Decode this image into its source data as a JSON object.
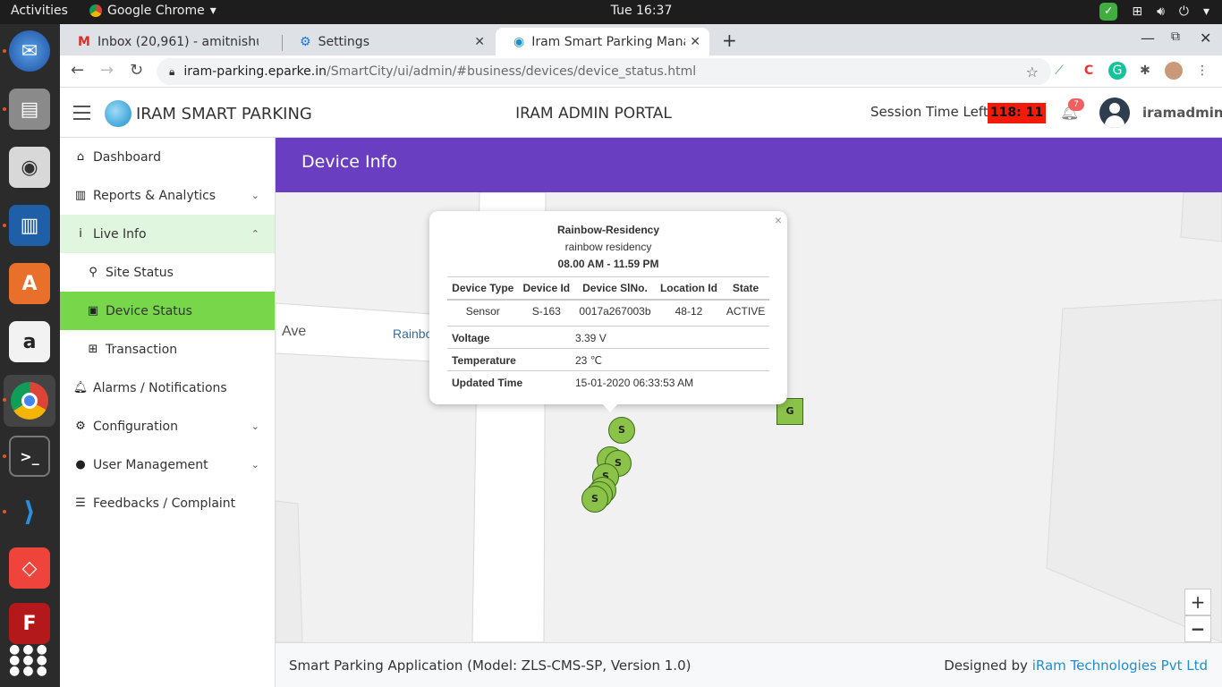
{
  "os": {
    "activities": "Activities",
    "app_name": "Google Chrome",
    "clock": "Tue 16:37"
  },
  "browser": {
    "tabs": [
      {
        "label": "Inbox (20,961) - amitnishu"
      },
      {
        "label": "Settings"
      },
      {
        "label": "Iram Smart Parking Mana"
      }
    ],
    "url_host": "iram-parking.eparke.in",
    "url_path": "/SmartCity/ui/admin/#business/devices/device_status.html"
  },
  "header": {
    "brand": "IRAM SMART PARKING",
    "portal_title": "IRAM ADMIN PORTAL",
    "session_label": "Session Time Left:",
    "session_timer": "118: 11",
    "notification_count": "7",
    "username": "iramadmin"
  },
  "sidebar": {
    "items": [
      {
        "label": "Dashboard"
      },
      {
        "label": "Reports & Analytics"
      },
      {
        "label": "Live Info"
      },
      {
        "label": "Site Status"
      },
      {
        "label": "Device Status"
      },
      {
        "label": "Transaction"
      },
      {
        "label": "Alarms / Notifications"
      },
      {
        "label": "Configuration"
      },
      {
        "label": "User Management"
      },
      {
        "label": "Feedbacks / Complaint"
      }
    ]
  },
  "page": {
    "title": "Device Info"
  },
  "map": {
    "street_labels": [
      "Ave",
      "Rainbo"
    ],
    "sensor_label": "S",
    "gateway_label": "G",
    "zoom_in": "+",
    "zoom_out": "−"
  },
  "popup": {
    "title": "Rainbow-Residency",
    "subtitle": "rainbow residency",
    "hours": "08.00 AM - 11.59 PM",
    "columns": [
      "Device Type",
      "Device Id",
      "Device SlNo.",
      "Location Id",
      "State"
    ],
    "row": [
      "Sensor",
      "S-163",
      "0017a267003b",
      "48-12",
      "ACTIVE"
    ],
    "voltage_label": "Voltage",
    "voltage_value": "3.39 V",
    "temperature_label": "Temperature",
    "temperature_value": "23 ℃",
    "updated_label": "Updated Time",
    "updated_value": "15-01-2020 06:33:53 AM",
    "close": "×"
  },
  "footer": {
    "left": "Smart Parking Application (Model: ZLS-CMS-SP, Version 1.0)",
    "designed_by": "Designed by",
    "company": "iRam Technologies Pvt Ltd"
  }
}
